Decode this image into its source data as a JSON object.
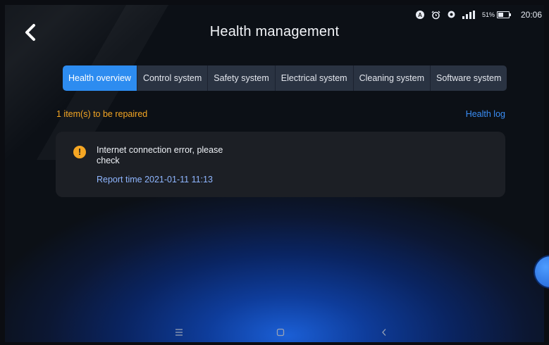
{
  "status_bar": {
    "battery_percent_label": "51%",
    "battery_level": 0.51,
    "time": "20:06",
    "icons": [
      "app-a-icon",
      "alarm-icon",
      "location-icon",
      "signal-icon",
      "battery-icon"
    ]
  },
  "header": {
    "title": "Health management",
    "back_icon": "chevron-left-icon"
  },
  "tabs": [
    {
      "label": "Health overview",
      "active": true
    },
    {
      "label": "Control system",
      "active": false
    },
    {
      "label": "Safety system",
      "active": false
    },
    {
      "label": "Electrical system",
      "active": false
    },
    {
      "label": "Cleaning system",
      "active": false
    },
    {
      "label": "Software system",
      "active": false
    }
  ],
  "summary": {
    "repair_count_text": "1 item(s) to be repaired",
    "health_log_label": "Health log"
  },
  "alerts": [
    {
      "icon": "warning-icon",
      "message": "Internet connection error, please check",
      "report_time": "Report time 2021-01-11 11:13"
    }
  ],
  "nav_bar": {
    "icons": [
      "menu-icon",
      "home-icon",
      "back-icon"
    ]
  },
  "colors": {
    "accent_blue": "#2d8cf0",
    "warning_orange": "#f5a623",
    "link_blue": "#3a8ef6",
    "card_bg": "#1c1f25",
    "tab_bg": "#2a3342"
  }
}
